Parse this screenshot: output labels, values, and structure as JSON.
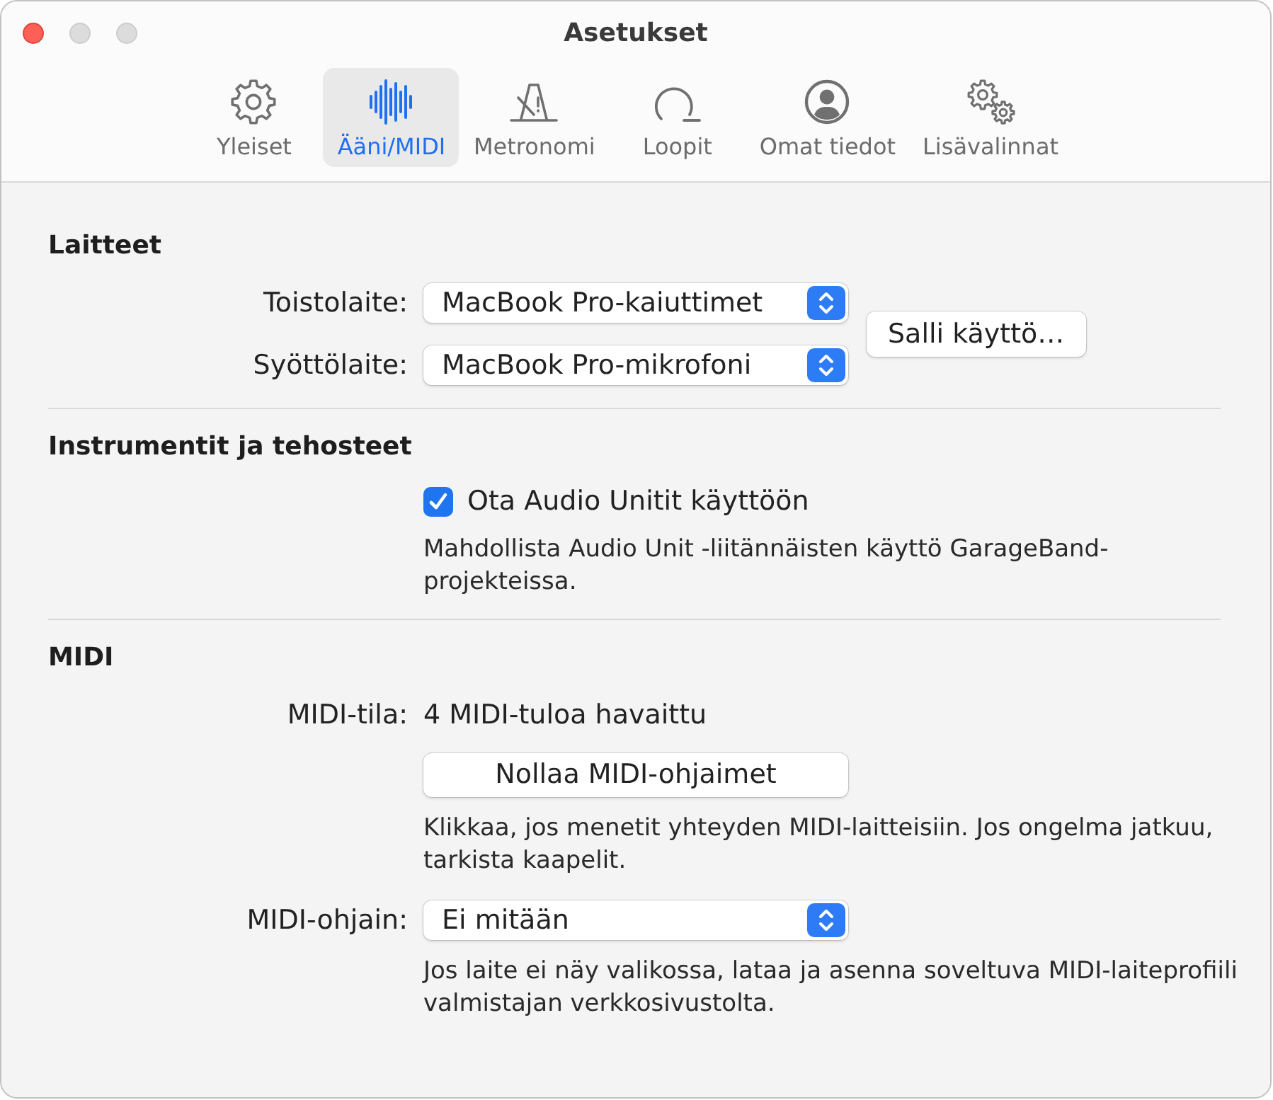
{
  "window": {
    "title": "Asetukset"
  },
  "tabs": [
    {
      "label": "Yleiset",
      "selected": false
    },
    {
      "label": "Ääni/MIDI",
      "selected": true
    },
    {
      "label": "Metronomi",
      "selected": false
    },
    {
      "label": "Loopit",
      "selected": false
    },
    {
      "label": "Omat tiedot",
      "selected": false
    },
    {
      "label": "Lisävalinnat",
      "selected": false
    }
  ],
  "sections": [
    {
      "title": "Laitteet",
      "rows": [
        {
          "kind": "select",
          "label": "Toistolaite:",
          "value": "MacBook Pro-kaiuttimet"
        },
        {
          "kind": "select",
          "label": "Syöttölaite:",
          "value": "MacBook Pro-mikrofoni"
        }
      ],
      "side_button": "Salli käyttö…"
    },
    {
      "title": "Instrumentit ja tehosteet",
      "rows": [
        {
          "kind": "checkbox",
          "text": "Ota Audio Unitit käyttöön",
          "checked": true
        },
        {
          "kind": "note",
          "text": "Mahdollista Audio Unit -liitännäisten käyttö GarageBand-projekteissa."
        }
      ]
    },
    {
      "title": "MIDI",
      "rows": [
        {
          "kind": "status",
          "label": "MIDI-tila:",
          "value": "4 MIDI-tuloa havaittu"
        },
        {
          "kind": "button",
          "text": "Nollaa MIDI-ohjaimet"
        },
        {
          "kind": "note",
          "text": "Klikkaa, jos menetit yhteyden MIDI-laitteisiin. Jos ongelma jatkuu, tarkista kaapelit."
        },
        {
          "kind": "select",
          "label": "MIDI-ohjain:",
          "value": "Ei mitään"
        },
        {
          "kind": "note",
          "text": "Jos laite ei näy valikossa, lataa ja asenna soveltuva MIDI-laiteprofiili valmistajan verkkosivustolta."
        }
      ]
    }
  ]
}
